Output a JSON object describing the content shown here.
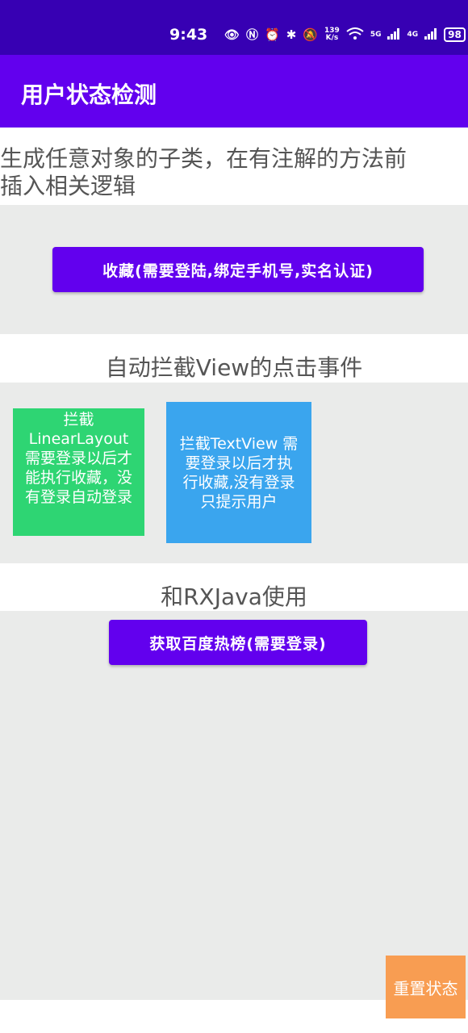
{
  "status_bar": {
    "time": "9:43",
    "net_speed_value": "139",
    "net_speed_unit": "K/s",
    "sim1": "5G",
    "sim2": "4G",
    "battery": "98"
  },
  "app_bar": {
    "title": "用户状态检测"
  },
  "intro": {
    "text": "生成任意对象的子类，在有注解的方法前\n插入相关逻辑"
  },
  "collect_button": {
    "label": "收藏(需要登陆,绑定手机号,实名认证)"
  },
  "intercept_section": {
    "heading": "自动拦截View的点击事件",
    "linear_layout_box": "拦截\nLinearLayout\n需要登录以后才\n能执行收藏，没\n有登录自动登录",
    "textview_box": "拦截TextView 需\n要登录以后才执\n行收藏,没有登录\n只提示用户"
  },
  "rx_section": {
    "heading": "和RXJava使用",
    "button_label": "获取百度热榜(需要登录)"
  },
  "reset_button": {
    "label": "重置状态"
  },
  "colors": {
    "status_bar": "#3700b3",
    "primary": "#6200ee",
    "panel_grey": "#eaebea",
    "green_box": "#2ed573",
    "blue_box": "#3aa5ee",
    "reset_orange": "#f89d52"
  },
  "icons": [
    "eye-icon",
    "nfc-icon",
    "alarm-icon",
    "bluetooth-icon",
    "mute-icon",
    "wifi-icon",
    "signal-icon",
    "battery-icon",
    "charging-icon"
  ]
}
